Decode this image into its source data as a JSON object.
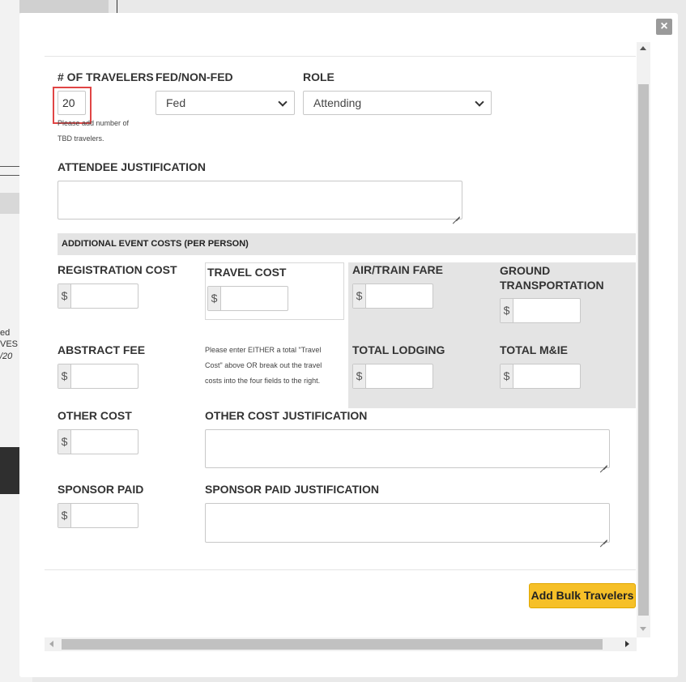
{
  "modal": {
    "close_label": "×",
    "travelers": {
      "label": "# OF TRAVELERS",
      "value": "20",
      "help": "Please add number of TBD travelers."
    },
    "fed": {
      "label": "FED/NON-FED",
      "selected": "Fed"
    },
    "role": {
      "label": "ROLE",
      "selected": "Attending"
    },
    "attendee_justification": {
      "label": "ATTENDEE JUSTIFICATION"
    },
    "section_title": "ADDITIONAL EVENT COSTS (PER PERSON)",
    "currency_symbol": "$",
    "registration_cost": {
      "label": "REGISTRATION COST"
    },
    "travel_cost": {
      "label": "TRAVEL COST"
    },
    "air_train_fare": {
      "label": "AIR/TRAIN FARE"
    },
    "ground_transportation": {
      "label_line1": "GROUND",
      "label_line2": "TRANSPORTATION"
    },
    "abstract_fee": {
      "label": "ABSTRACT FEE"
    },
    "travel_note": {
      "line1": "Please enter EITHER a total \"Travel",
      "line2": "Cost\" above OR break out the travel",
      "line3": "costs into the four fields to the right."
    },
    "total_lodging": {
      "label": "TOTAL LODGING"
    },
    "total_mie": {
      "label": "TOTAL M&IE"
    },
    "other_cost": {
      "label": "OTHER COST"
    },
    "other_cost_justification": {
      "label": "OTHER COST JUSTIFICATION"
    },
    "sponsor_paid": {
      "label": "SPONSOR PAID"
    },
    "sponsor_paid_justification": {
      "label": "SPONSOR PAID JUSTIFICATION"
    },
    "submit_label": "Add Bulk Travelers"
  },
  "background": {
    "text_line1": "ed",
    "text_line2": "VES",
    "text_line3": "/20"
  },
  "colors": {
    "accent_button": "#f6c028",
    "highlight_border": "#e04545",
    "section_bg": "#e4e4e4"
  }
}
